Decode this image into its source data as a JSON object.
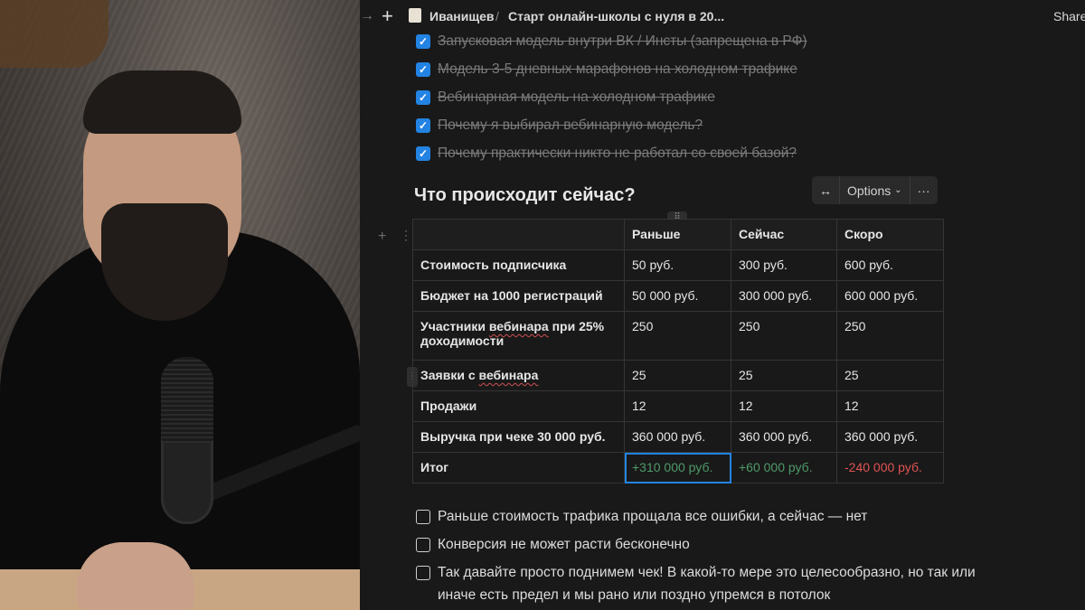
{
  "topbar": {
    "crumb_owner": "Иванищев",
    "separator": "/",
    "crumb_page": "Старт онлайн-школы с нуля в 20...",
    "share_label": "Share"
  },
  "done_items": [
    "Запусковая модель внутри ВК / Инсты (запрещена в РФ)",
    "Модель 3-5 дневных марафонов на холодном трафике",
    "Вебинарная модель на холодном трафике",
    "Почему я выбирал вебинарную модель?",
    "Почему практически никто не работал со своей базой?"
  ],
  "heading": "Что происходит сейчас?",
  "table_toolbar": {
    "width_icon": "↔",
    "options_label": "Options",
    "more_icon": "···"
  },
  "table": {
    "headers": [
      "",
      "Раньше",
      "Сейчас",
      "Скоро"
    ],
    "rows": [
      {
        "label": "Стоимость подписчика",
        "before": "50 руб.",
        "now": "300 руб.",
        "soon": "600 руб."
      },
      {
        "label": "Бюджет на 1000 регистраций",
        "before": "50 000 руб.",
        "now": "300 000 руб.",
        "soon": "600 000 руб."
      },
      {
        "label_a": "Участники",
        "label_b": "вебинара",
        "label_c": " при 25% доходимости",
        "before": "250",
        "now": "250",
        "soon": "250"
      },
      {
        "label_a": "Заявки с ",
        "label_b": "вебинара",
        "before": "25",
        "now": "25",
        "soon": "25"
      },
      {
        "label": "Продажи",
        "before": "12",
        "now": "12",
        "soon": "12"
      },
      {
        "label": "Выручка при чеке 30 000 руб.",
        "before": "360 000 руб.",
        "now": "360 000 руб.",
        "soon": "360 000 руб."
      },
      {
        "label": "Итог",
        "before": "+310 000 руб.",
        "now": "+60 000 руб.",
        "soon": "-240 000 руб."
      }
    ]
  },
  "open_items": [
    "Раньше стоимость трафика прощала все ошибки, а сейчас — нет",
    "Конверсия не может расти бесконечно",
    "Так давайте просто поднимем чек! В какой-то мере это целесообразно, но так или",
    "иначе есть предел и мы рано или поздно упремся в потолок"
  ],
  "colors": {
    "accent": "#2383e2",
    "positive": "#4f9a6a",
    "negative": "#df5452",
    "background": "#191919"
  }
}
